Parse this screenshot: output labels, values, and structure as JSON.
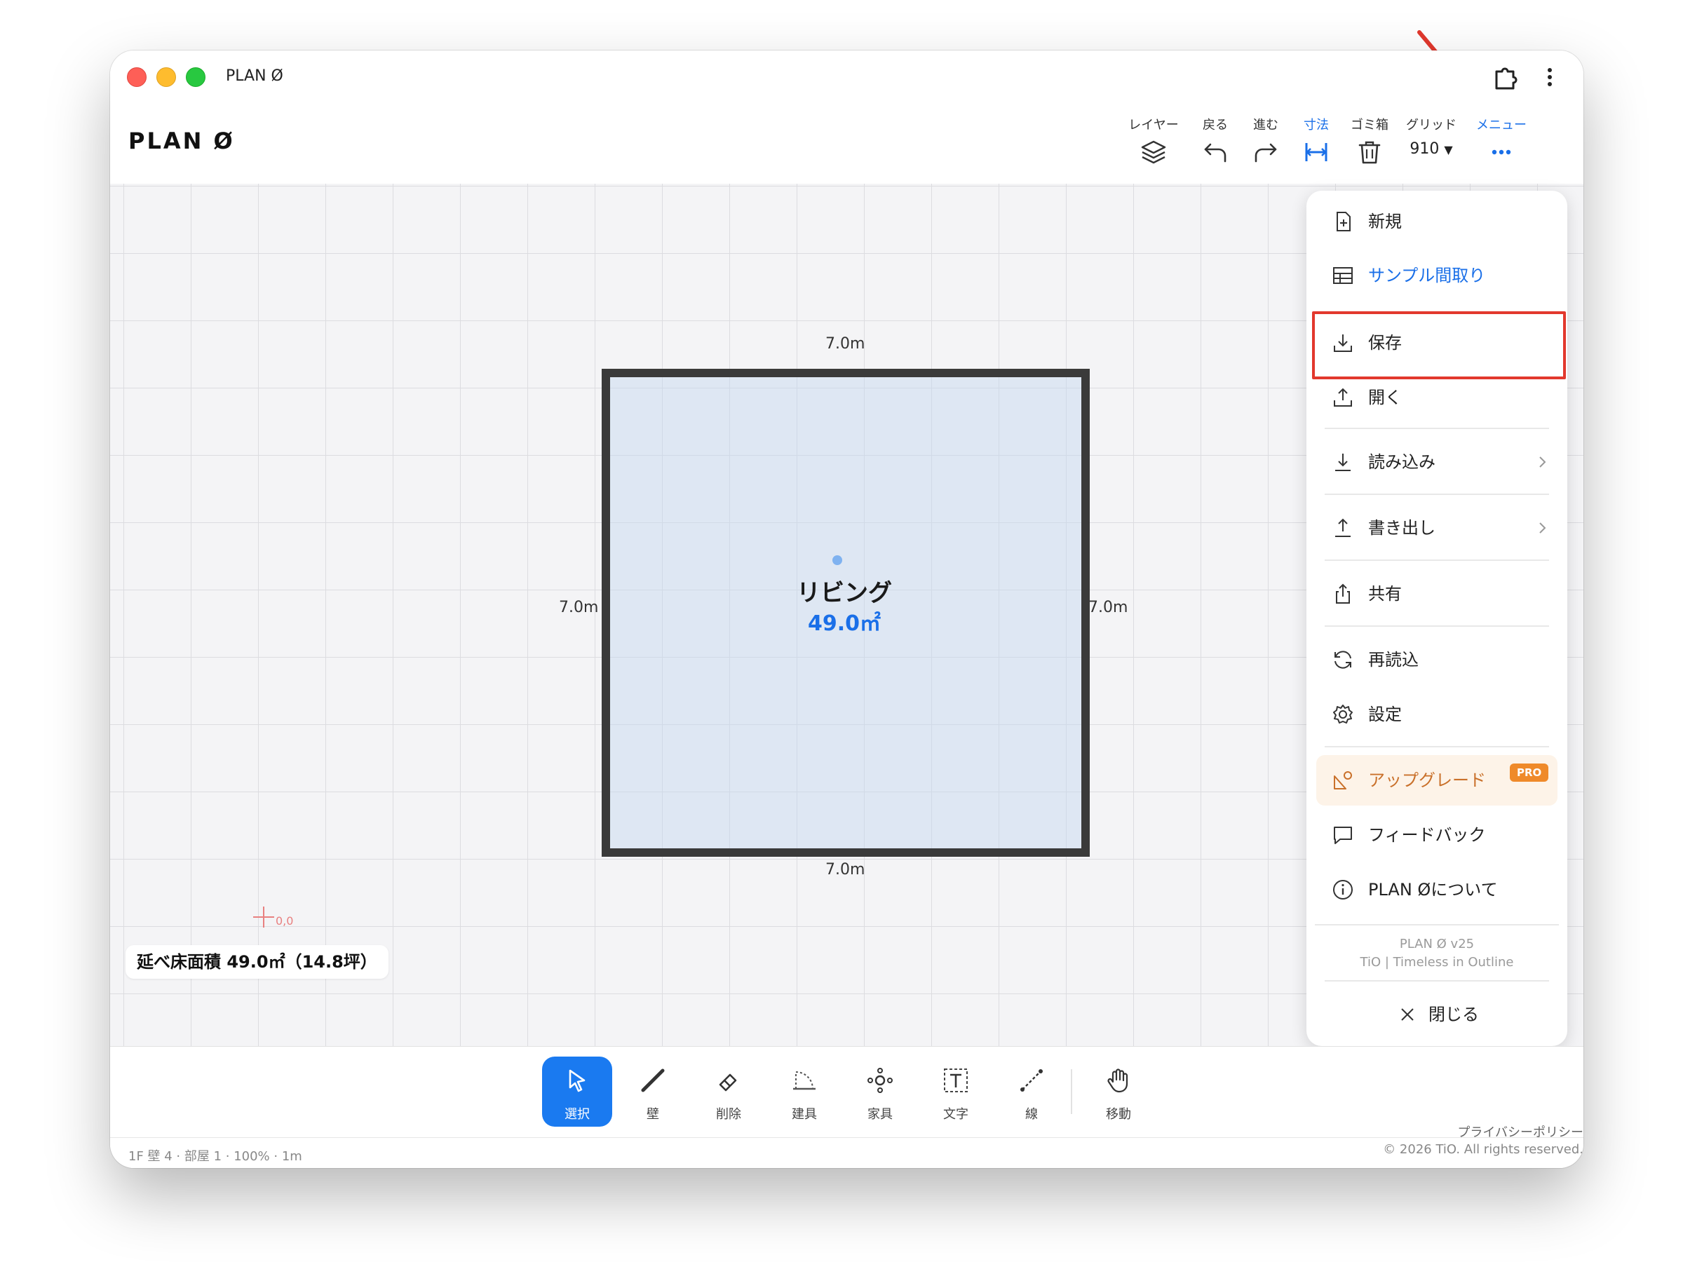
{
  "window": {
    "title": "PLAN Ø"
  },
  "app": {
    "logo": "PLAN Ø",
    "floor": "1F"
  },
  "toolbar": {
    "layer": "レイヤー",
    "undo": "戻る",
    "redo": "進む",
    "dimension": "寸法",
    "trash": "ゴミ箱",
    "grid": "グリッド",
    "grid_value": "910",
    "menu": "メニュー"
  },
  "canvas": {
    "room": {
      "name": "リビング",
      "area": "49.0㎡"
    },
    "dims": {
      "top": "7.0m",
      "bottom": "7.0m",
      "left": "7.0m",
      "right": "7.0m"
    },
    "origin_label": "0,0",
    "total_area": "延べ床面積 49.0㎡（14.8坪）"
  },
  "menu": {
    "items": [
      {
        "label": "新規",
        "icon": "new-file-icon"
      },
      {
        "label": "サンプル間取り",
        "icon": "grid-icon"
      },
      {
        "label": "保存",
        "icon": "save-icon"
      },
      {
        "label": "開く",
        "icon": "open-icon"
      },
      {
        "label": "読み込み",
        "icon": "import-icon"
      },
      {
        "label": "書き出し",
        "icon": "export-icon"
      },
      {
        "label": "共有",
        "icon": "share-icon"
      },
      {
        "label": "再読込",
        "icon": "reload-icon"
      },
      {
        "label": "設定",
        "icon": "gear-icon"
      },
      {
        "label": "アップグレード",
        "icon": "upgrade-icon"
      },
      {
        "label": "フィードバック",
        "icon": "feedback-icon"
      },
      {
        "label": "PLAN Øについて",
        "icon": "info-icon"
      }
    ],
    "pro_badge": "PRO",
    "version": "PLAN Ø v25",
    "company": "TiO | Timeless in Outline",
    "close": "閉じる"
  },
  "tools": [
    {
      "label": "選択",
      "icon": "cursor-icon",
      "active": true
    },
    {
      "label": "壁",
      "icon": "wall-icon"
    },
    {
      "label": "削除",
      "icon": "eraser-icon"
    },
    {
      "label": "建具",
      "icon": "door-icon"
    },
    {
      "label": "家具",
      "icon": "furniture-icon"
    },
    {
      "label": "文字",
      "icon": "text-icon"
    },
    {
      "label": "線",
      "icon": "line-icon"
    },
    {
      "label": "移動",
      "icon": "hand-icon"
    }
  ],
  "footer": {
    "privacy": "プライバシーポリシー",
    "copyright": "© 2026 TiO. All rights reserved.",
    "status": "1F 壁 4 · 部屋 1 · 100% · 1m"
  },
  "colors": {
    "accent": "#1a7af0",
    "highlight": "#e2382d",
    "upgrade": "#ef8a2a"
  }
}
